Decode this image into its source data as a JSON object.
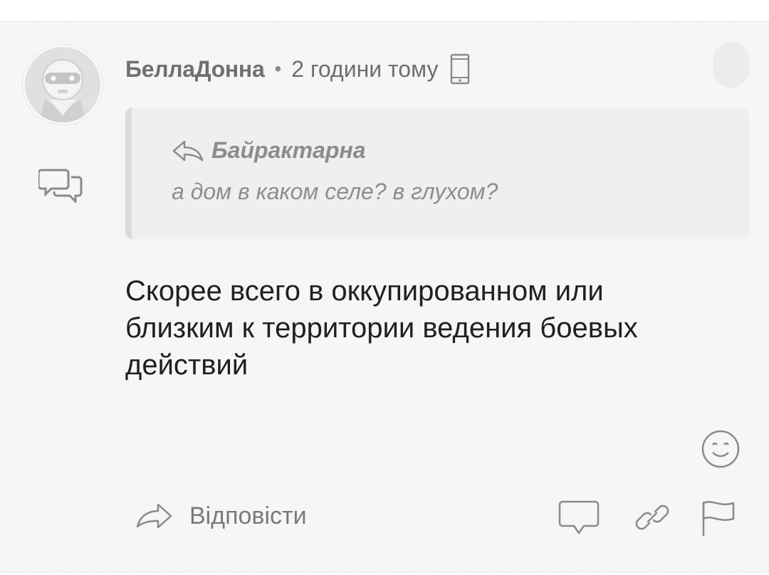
{
  "comment": {
    "author": "БеллаДонна",
    "separator": "•",
    "timestamp": "2 години тому",
    "device_icon": "mobile-phone-icon",
    "quote": {
      "author": "Байрактарна",
      "text": "а дом в каком селе? в глухом?"
    },
    "body_lines": [
      "Скорее всего в оккупированном или",
      "близким к территории ведения боевых",
      "действий"
    ],
    "actions": {
      "reply_label": "Відповісти"
    }
  },
  "icons": {
    "avatar": "robot-avatar-icon",
    "side": "speech-bubbles-icon",
    "quote_reply": "reply-arrow-icon",
    "emoji": "smiley-icon",
    "reply": "reply-arrow-icon",
    "comment": "comment-bubble-icon",
    "link": "link-icon",
    "flag": "flag-icon"
  },
  "colors": {
    "background": "#f6f6f6",
    "quote_background": "#efefef",
    "quote_border": "#dadada",
    "body_text": "#202020",
    "muted_text": "#707070",
    "icon_stroke": "#8a8a8a"
  }
}
